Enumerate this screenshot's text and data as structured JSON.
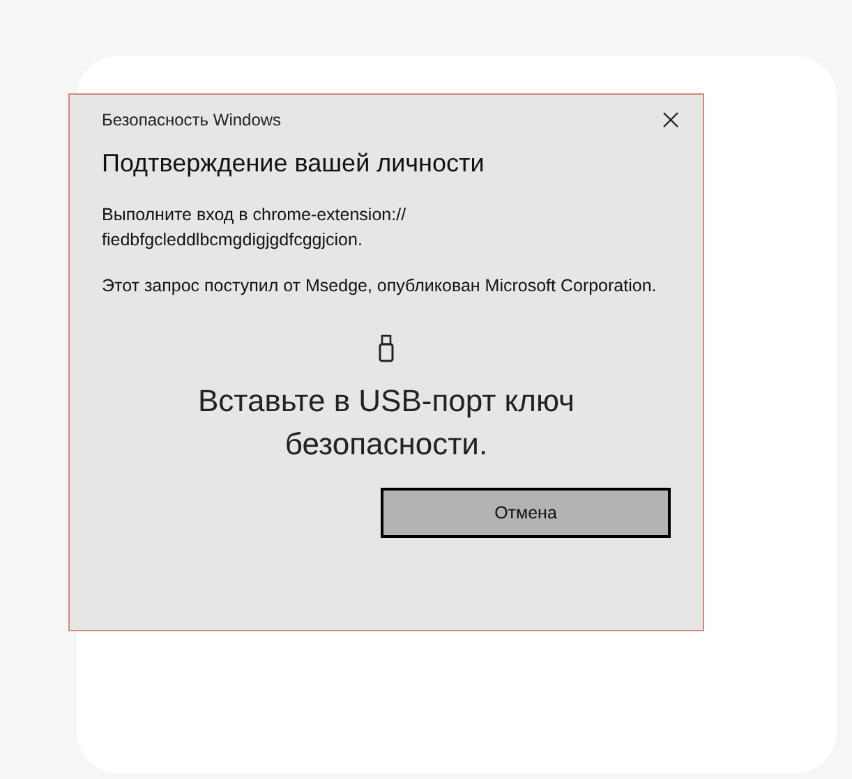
{
  "dialog": {
    "title": "Безопасность Windows",
    "heading": "Подтверждение вашей личности",
    "paragraphs": [
      "Выполните вход в chrome-extension://\nfiedbfgcleddlbcmgdigjgdfcggjcion.",
      "Этот запрос поступил от Msedge, опубликован Microsoft Corporation."
    ],
    "prompt": "Вставьте в USB-порт ключ безопасности.",
    "buttons": [
      {
        "label": "Отмена",
        "selected": true
      }
    ]
  }
}
